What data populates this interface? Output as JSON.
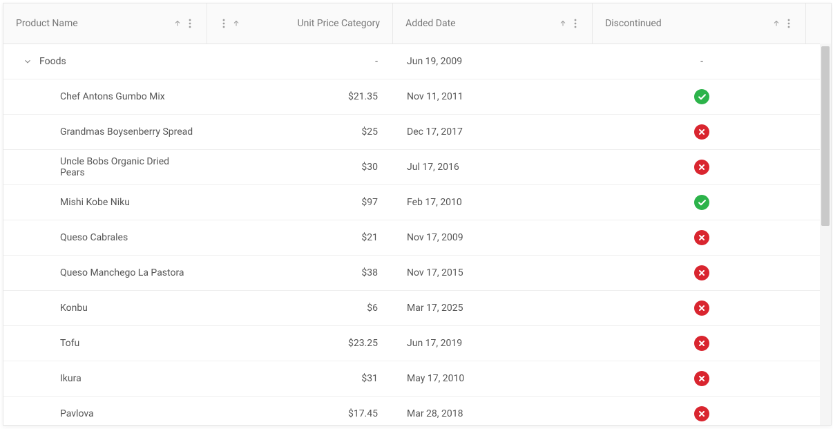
{
  "columns": {
    "product_name": "Product Name",
    "unit_price_category": "Unit Price Category",
    "added_date": "Added Date",
    "discontinued": "Discontinued"
  },
  "group": {
    "label": "Foods",
    "price_display": "-",
    "date_display": "Jun 19, 2009",
    "discontinued_display": "-"
  },
  "rows": [
    {
      "name": "Chef Antons Gumbo Mix",
      "price": "$21.35",
      "date": "Nov 11, 2011",
      "discontinued": true
    },
    {
      "name": "Grandmas Boysenberry Spread",
      "price": "$25",
      "date": "Dec 17, 2017",
      "discontinued": false
    },
    {
      "name": "Uncle Bobs Organic Dried Pears",
      "price": "$30",
      "date": "Jul 17, 2016",
      "discontinued": false
    },
    {
      "name": "Mishi Kobe Niku",
      "price": "$97",
      "date": "Feb 17, 2010",
      "discontinued": true
    },
    {
      "name": "Queso Cabrales",
      "price": "$21",
      "date": "Nov 17, 2009",
      "discontinued": false
    },
    {
      "name": "Queso Manchego La Pastora",
      "price": "$38",
      "date": "Nov 17, 2015",
      "discontinued": false
    },
    {
      "name": "Konbu",
      "price": "$6",
      "date": "Mar 17, 2025",
      "discontinued": false
    },
    {
      "name": "Tofu",
      "price": "$23.25",
      "date": "Jun 17, 2019",
      "discontinued": false
    },
    {
      "name": "Ikura",
      "price": "$31",
      "date": "May 17, 2010",
      "discontinued": false
    },
    {
      "name": "Pavlova",
      "price": "$17.45",
      "date": "Mar 28, 2018",
      "discontinued": false
    }
  ]
}
